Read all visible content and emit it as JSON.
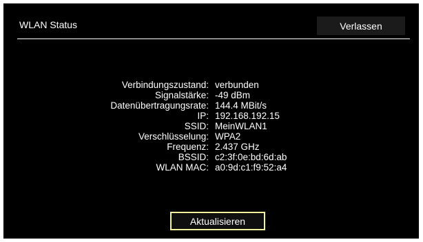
{
  "header": {
    "title": "WLAN Status",
    "exit_label": "Verlassen"
  },
  "status": [
    {
      "label": "Verbindungszustand:",
      "value": "verbunden"
    },
    {
      "label": "Signalstärke:",
      "value": "-49 dBm"
    },
    {
      "label": "Datenübertragungsrate:",
      "value": "144.4 MBit/s"
    },
    {
      "label": "IP:",
      "value": "192.168.192.15"
    },
    {
      "label": "SSID:",
      "value": "MeinWLAN1"
    },
    {
      "label": "Verschlüsselung:",
      "value": "WPA2"
    },
    {
      "label": "Frequenz:",
      "value": "2.437 GHz"
    },
    {
      "label": "BSSID:",
      "value": "c2:3f:0e:bd:6d:ab"
    },
    {
      "label": "WLAN MAC:",
      "value": "a0:9d:c1:f9:52:a4"
    }
  ],
  "actions": {
    "refresh_label": "Aktualisieren"
  },
  "colors": {
    "background": "#000000",
    "text": "#ffffff",
    "focus_border": "#f3f39a"
  }
}
